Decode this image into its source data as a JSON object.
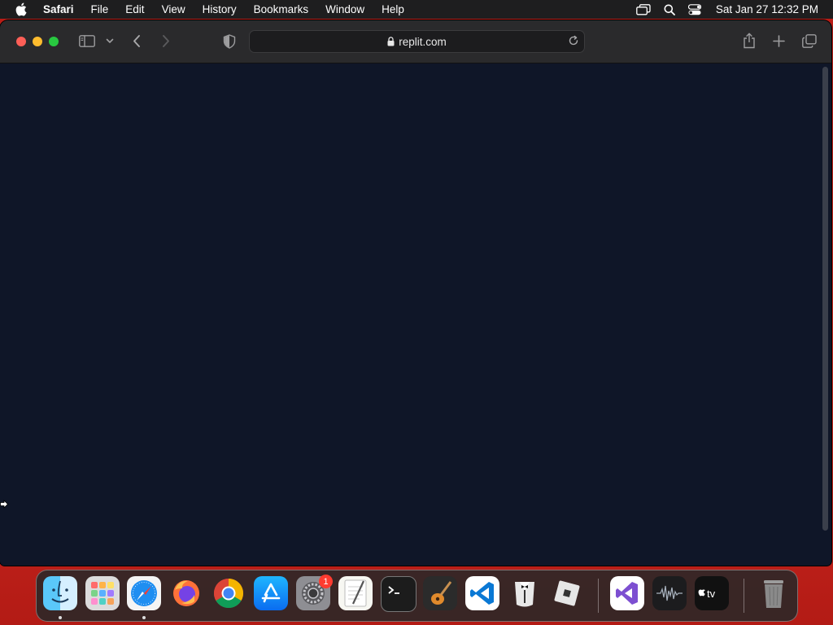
{
  "menubar": {
    "app_name": "Safari",
    "items": [
      "File",
      "Edit",
      "View",
      "History",
      "Bookmarks",
      "Window",
      "Help"
    ],
    "clock": "Sat Jan 27  12:32 PM",
    "status_icons": [
      "screen-mirroring-icon",
      "spotlight-search-icon",
      "control-center-icon"
    ]
  },
  "browser": {
    "url": "replit.com",
    "content_background": "#0f1628"
  },
  "dock": {
    "apps": [
      "finder",
      "launchpad",
      "safari",
      "firefox",
      "chrome",
      "app-store",
      "system-settings",
      "textedit",
      "terminal",
      "garageband",
      "vscode",
      "bartender",
      "roblox",
      "visual-studio",
      "voice-memos",
      "apple-tv",
      "trash"
    ],
    "settings_badge": "1"
  }
}
